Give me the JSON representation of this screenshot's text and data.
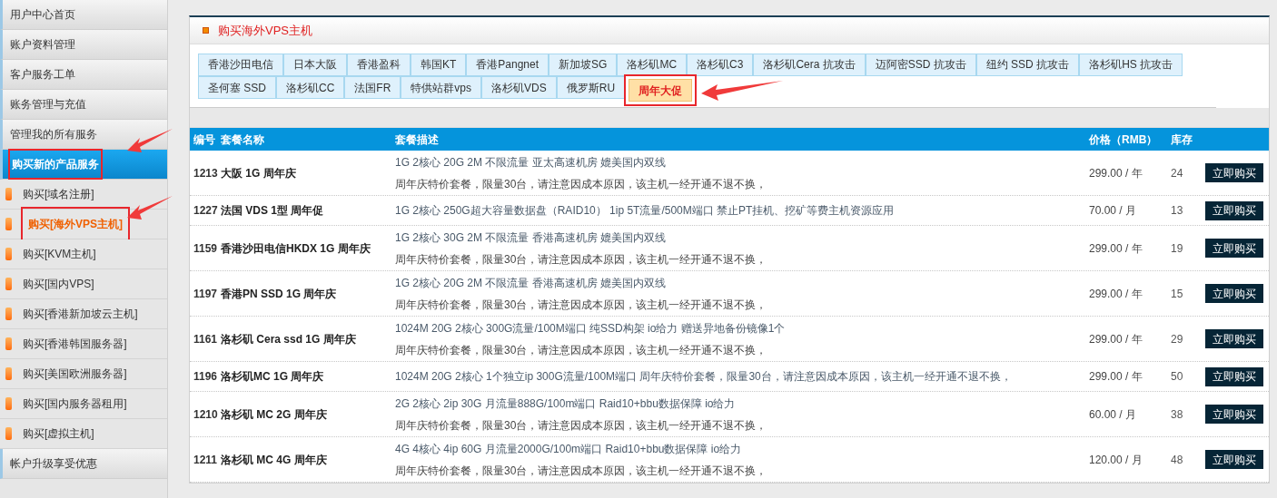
{
  "sidebar": {
    "items": [
      {
        "label": "用户中心首页",
        "kind": "section",
        "selected": false,
        "highlighted": false
      },
      {
        "label": "账户资料管理",
        "kind": "section",
        "selected": false,
        "highlighted": false
      },
      {
        "label": "客户服务工单",
        "kind": "section",
        "selected": false,
        "highlighted": false
      },
      {
        "label": "账务管理与充值",
        "kind": "section",
        "selected": false,
        "highlighted": false
      },
      {
        "label": "管理我的所有服务",
        "kind": "section",
        "selected": false,
        "highlighted": false
      },
      {
        "label": "购买新的产品服务",
        "kind": "section",
        "selected": true,
        "highlighted": true
      },
      {
        "label": "购买[域名注册]",
        "kind": "sub",
        "selected": false,
        "highlighted": false
      },
      {
        "label": "购买[海外VPS主机]",
        "kind": "sub",
        "selected": true,
        "highlighted": true
      },
      {
        "label": "购买[KVM主机]",
        "kind": "sub",
        "selected": false,
        "highlighted": false
      },
      {
        "label": "购买[国内VPS]",
        "kind": "sub",
        "selected": false,
        "highlighted": false
      },
      {
        "label": "购买[香港新加坡云主机]",
        "kind": "sub",
        "selected": false,
        "highlighted": false
      },
      {
        "label": "购买[香港韩国服务器]",
        "kind": "sub",
        "selected": false,
        "highlighted": false
      },
      {
        "label": "购买[美国欧洲服务器]",
        "kind": "sub",
        "selected": false,
        "highlighted": false
      },
      {
        "label": "购买[国内服务器租用]",
        "kind": "sub",
        "selected": false,
        "highlighted": false
      },
      {
        "label": "购买[虚拟主机]",
        "kind": "sub",
        "selected": false,
        "highlighted": false
      },
      {
        "label": "帐户升级享受优惠",
        "kind": "section",
        "selected": false,
        "highlighted": false
      }
    ]
  },
  "panel": {
    "title": "购买海外VPS主机",
    "tabs": [
      {
        "label": "香港沙田电信",
        "selected": false,
        "highlighted": false
      },
      {
        "label": "日本大阪",
        "selected": false,
        "highlighted": false
      },
      {
        "label": "香港盈科",
        "selected": false,
        "highlighted": false
      },
      {
        "label": "韩国KT",
        "selected": false,
        "highlighted": false
      },
      {
        "label": "香港Pangnet",
        "selected": false,
        "highlighted": false
      },
      {
        "label": "新加坡SG",
        "selected": false,
        "highlighted": false
      },
      {
        "label": "洛杉矶MC",
        "selected": false,
        "highlighted": false
      },
      {
        "label": "洛杉矶C3",
        "selected": false,
        "highlighted": false
      },
      {
        "label": "洛杉矶Cera 抗攻击",
        "selected": false,
        "highlighted": false
      },
      {
        "label": "迈阿密SSD 抗攻击",
        "selected": false,
        "highlighted": false
      },
      {
        "label": "纽约 SSD 抗攻击",
        "selected": false,
        "highlighted": false
      },
      {
        "label": "洛杉矶HS 抗攻击",
        "selected": false,
        "highlighted": false
      },
      {
        "label": "圣何塞 SSD",
        "selected": false,
        "highlighted": false
      },
      {
        "label": "洛杉矶CC",
        "selected": false,
        "highlighted": false
      },
      {
        "label": "法国FR",
        "selected": false,
        "highlighted": false
      },
      {
        "label": "特供站群vps",
        "selected": false,
        "highlighted": false
      },
      {
        "label": "洛杉矶VDS",
        "selected": false,
        "highlighted": false
      },
      {
        "label": "俄罗斯RU",
        "selected": false,
        "highlighted": false
      },
      {
        "label": "周年大促",
        "selected": true,
        "highlighted": true
      }
    ]
  },
  "table": {
    "columns": [
      "编号",
      "套餐名称",
      "套餐描述",
      "价格（RMB）",
      "库存"
    ],
    "rows": [
      {
        "id": "1213",
        "name": "大阪 1G 周年庆",
        "description": [
          "1G 2核心 20G 2M 不限流量 亚太高速机房 媲美国内双线",
          "周年庆特价套餐，限量30台，请注意因成本原因，该主机一经开通不退不换，"
        ],
        "price": "299.00 / 年",
        "stock": "24",
        "action": "立即购买"
      },
      {
        "id": "1227",
        "name": "法国 VDS 1型 周年促",
        "description": [
          "1G 2核心  250G超大容量数据盘（RAID10） 1ip  5T流量/500M端口 禁止PT挂机、挖矿等费主机资源应用"
        ],
        "price": "70.00 / 月",
        "stock": "13",
        "action": "立即购买"
      },
      {
        "id": "1159",
        "name": "香港沙田电信HKDX 1G 周年庆",
        "description": [
          "1G 2核心 30G 2M 不限流量 香港高速机房 媲美国内双线",
          "周年庆特价套餐，限量30台，请注意因成本原因，该主机一经开通不退不换，"
        ],
        "price": "299.00 / 年",
        "stock": "19",
        "action": "立即购买"
      },
      {
        "id": "1197",
        "name": "香港PN SSD 1G 周年庆",
        "description": [
          "1G 2核心 20G 2M 不限流量 香港高速机房 媲美国内双线",
          "周年庆特价套餐，限量30台，请注意因成本原因，该主机一经开通不退不换，"
        ],
        "price": "299.00 / 年",
        "stock": "15",
        "action": "立即购买"
      },
      {
        "id": "1161",
        "name": "洛杉矶 Cera ssd 1G 周年庆",
        "description": [
          "1024M 20G 2核心 300G流量/100M端口 纯SSD构架 io给力 赠送异地备份镜像1个",
          "周年庆特价套餐，限量30台，请注意因成本原因，该主机一经开通不退不换，"
        ],
        "price": "299.00 / 年",
        "stock": "29",
        "action": "立即购买"
      },
      {
        "id": "1196",
        "name": "洛杉矶MC 1G 周年庆",
        "description": [
          "1024M 20G 2核心 1个独立ip 300G流量/100M端口 周年庆特价套餐，限量30台，请注意因成本原因，该主机一经开通不退不换，"
        ],
        "price": "299.00 / 年",
        "stock": "50",
        "action": "立即购买"
      },
      {
        "id": "1210",
        "name": "洛杉矶 MC 2G 周年庆",
        "description": [
          "2G 2核心 2ip 30G 月流量888G/100m端口 Raid10+bbu数据保障 io给力",
          "周年庆特价套餐，限量30台，请注意因成本原因，该主机一经开通不退不换，"
        ],
        "price": "60.00 / 月",
        "stock": "38",
        "action": "立即购买"
      },
      {
        "id": "1211",
        "name": "洛杉矶 MC 4G 周年庆",
        "description": [
          "4G 4核心 4ip 60G 月流量2000G/100m端口 Raid10+bbu数据保障 io给力",
          "周年庆特价套餐，限量30台，请注意因成本原因，该主机一经开通不退不换，"
        ],
        "price": "120.00 / 月",
        "stock": "48",
        "action": "立即购买"
      }
    ]
  }
}
